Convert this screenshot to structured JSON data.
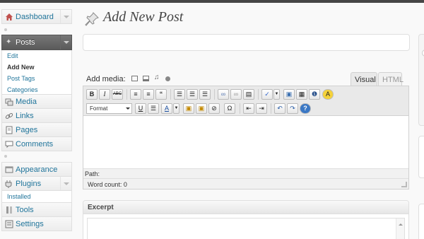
{
  "sidebar": {
    "dashboard": "Dashboard",
    "posts": {
      "label": "Posts",
      "submenu": [
        "Edit",
        "Add New",
        "Post Tags",
        "Categories"
      ]
    },
    "media": "Media",
    "links": "Links",
    "pages": "Pages",
    "comments": "Comments",
    "appearance": "Appearance",
    "plugins": {
      "label": "Plugins",
      "submenu": [
        "Installed"
      ]
    },
    "tools": "Tools",
    "settings": "Settings"
  },
  "main": {
    "page_title": "Add New Post",
    "title_input": {
      "value": "",
      "placeholder": ""
    },
    "add_media_label": "Add media:",
    "tabs": {
      "visual": "Visual",
      "html": "HTML"
    },
    "toolbar": {
      "bold": "B",
      "italic": "I",
      "strike": "ABC",
      "format_select": "Format",
      "underline": "U",
      "text_color": "A",
      "special_char": "Ω"
    },
    "path_label": "Path:",
    "word_count": "Word count: 0",
    "excerpt_title": "Excerpt"
  },
  "colors": {
    "link": "#21759b",
    "posts_header_bg": "#5f5f5f",
    "topbar": "#464646"
  },
  "icons": [
    "home-icon",
    "pushpin-icon",
    "media-icon",
    "links-icon",
    "pages-icon",
    "comments-icon",
    "appearance-icon",
    "plugins-icon",
    "tools-icon",
    "settings-icon"
  ]
}
